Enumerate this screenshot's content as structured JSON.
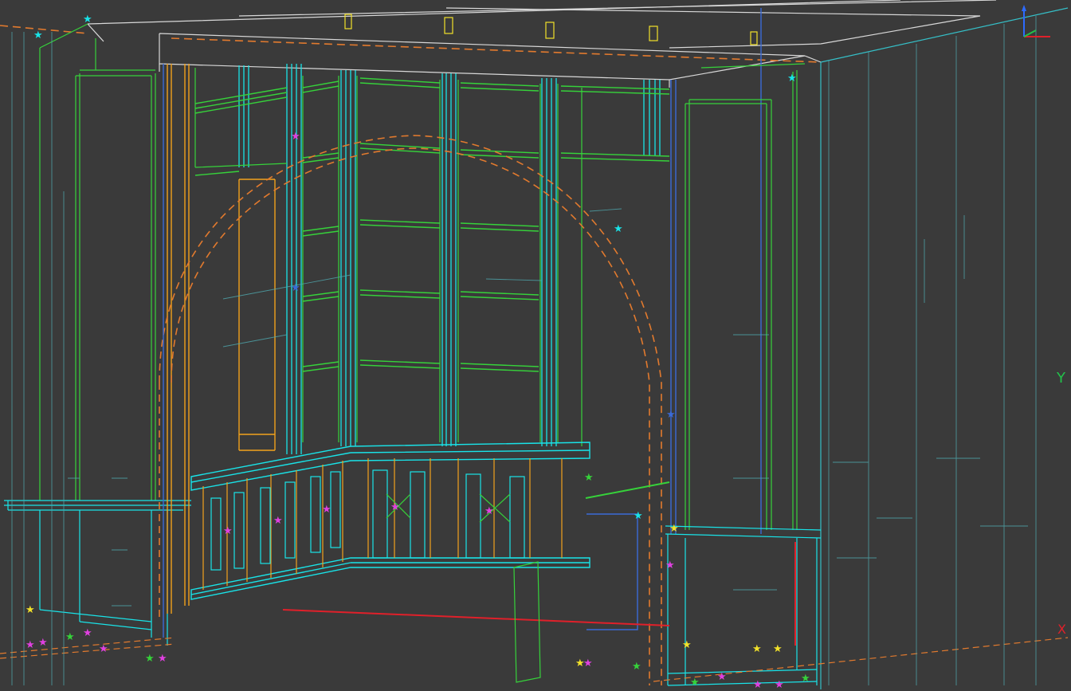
{
  "viewport": {
    "background": "#3a3a3a"
  },
  "axes": {
    "y_label": "Y",
    "x_label": "X",
    "y_color": "#22c14a",
    "x_color": "#e0202a",
    "z_color": "#2d6bff"
  },
  "palette": {
    "cyan": "#19e3e8",
    "teal": "#35bfc7",
    "dim_teal": "#4fa8ae",
    "green": "#36d23a",
    "orange": "#f2a21c",
    "dashed_orange": "#e27a2e",
    "blue": "#3a6ad8",
    "white": "#d8d8d8",
    "red": "#e0202a",
    "magenta": "#e040e0",
    "yellow": "#f2e22a"
  }
}
